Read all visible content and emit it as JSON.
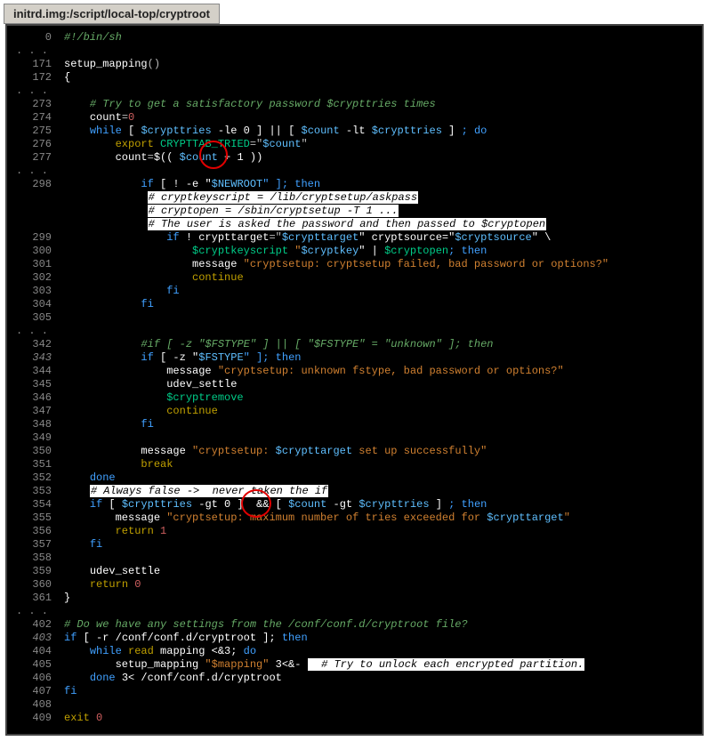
{
  "title": "initrd.img:/script/local-top/cryptroot",
  "ellipsis": ". . .",
  "ln": {
    "l0": "0",
    "l171": "171",
    "l172": "172",
    "l273": "273",
    "l274": "274",
    "l275": "275",
    "l276": "276",
    "l277": "277",
    "l298": "298",
    "l299": "299",
    "l300": "300",
    "l301": "301",
    "l302": "302",
    "l303": "303",
    "l304": "304",
    "l305": "305",
    "l342": "342",
    "l343": "343",
    "l344": "344",
    "l345": "345",
    "l346": "346",
    "l347": "347",
    "l348": "348",
    "l349": "349",
    "l350": "350",
    "l351": "351",
    "l352": "352",
    "l353": "353",
    "l354": "354",
    "l355": "355",
    "l356": "356",
    "l357": "357",
    "l358": "358",
    "l359": "359",
    "l360": "360",
    "l361": "361",
    "l402": "402",
    "l403": "403",
    "l404": "404",
    "l405": "405",
    "l406": "406",
    "l407": "407",
    "l408": "408",
    "l409": "409"
  },
  "t": {
    "shebang": "#!/bin/sh",
    "setup_mapping": "setup_mapping",
    "parens": "()",
    "obrace": "{",
    "cbrace": "}",
    "try_comment": "# Try to get a satisfactory password $crypttries times",
    "count": "count",
    "eq": "=",
    "zero": "0",
    "while": "while",
    "lbr": " [ ",
    "rbr": " ] ",
    "crypttries": "$crypttries",
    "le0": " -le 0",
    "orop": "|| [ ",
    "count_var": "$count",
    "lt": " -lt ",
    "do": "; do",
    "export": "export",
    "CRYPTTAB_TRIED": " CRYPTTAB_TRIED",
    "eqq": "=\"",
    "endq": "\"",
    "dollparen": "$(( ",
    "plus1": " + 1",
    "closeparen": " ))",
    "if": "if",
    "not_e": " [ ! -e \"",
    "NEWROOT": "$NEWROOT",
    "then": "\" ]; then",
    "hc1": "# cryptkeyscript = /lib/cryptsetup/askpass",
    "hc2": "# cryptopen = /sbin/cryptsetup -T 1 ...",
    "hc3": "# The user is asked the password and then passed to $cryptopen",
    "ifnot": " ! ",
    "crypttarget": "crypttarget",
    "eq2": "=\"",
    "vcrypttarget": "$crypttarget",
    "cs": "\" cryptsource=\"",
    "vcryptsource": "$cryptsource",
    "bsl": "\" \\",
    "cryptkeyscript": "$cryptkeyscript",
    "spq": " \"",
    "cryptkey": "$cryptkey",
    "pipe": "\" | ",
    "cryptopen": "$cryptopen",
    "semi_then": "; then",
    "message": "message",
    "msg_badpw": " \"cryptsetup: cryptsetup failed, bad password or options?\"",
    "continue": "continue",
    "fi": "fi",
    "old_if": "#if [ -z \"$FSTYPE\" ] || [ \"$FSTYPE\" = \"unknown\" ]; then",
    "z": " [ -z \"",
    "FSTYPE": "$FSTYPE",
    "msg_unknown": " \"cryptsetup: unknown fstype, bad password or options?\"",
    "udev_settle": "udev_settle",
    "cryptremove": "$cryptremove",
    "msg_ok_a": " \"cryptsetup: ",
    "msg_ok_b": " set up successfully\"",
    "break": "break",
    "done": "done",
    "always_false": "# Always false ->  never taken the if",
    "gt0": " -gt 0",
    "and": " && [ ",
    "gt": " -gt ",
    "msg_max_a": " \"cryptsetup: maximum number of tries exceeded for ",
    "return": "return",
    "one": " 1",
    "zerosp": " 0",
    "conf_comment": "# Do we have any settings from the /conf/conf.d/cryptroot file?",
    "r_test": " [ -r /conf/conf.d/cryptroot ]; ",
    "then_kw": "then",
    "read": "read",
    "mapping_word": " mapping ",
    "redir_in": "<&3; ",
    "do_kw": "do",
    "sm_call": "setup_mapping",
    "mapping_var": " \"$mapping\"",
    "three": " 3<&- ",
    "hl_try": "  # Try to unlock each encrypted partition.",
    "done_redir": " 3< /conf/conf.d/cryptroot",
    "exit": "exit",
    "sp": " "
  }
}
